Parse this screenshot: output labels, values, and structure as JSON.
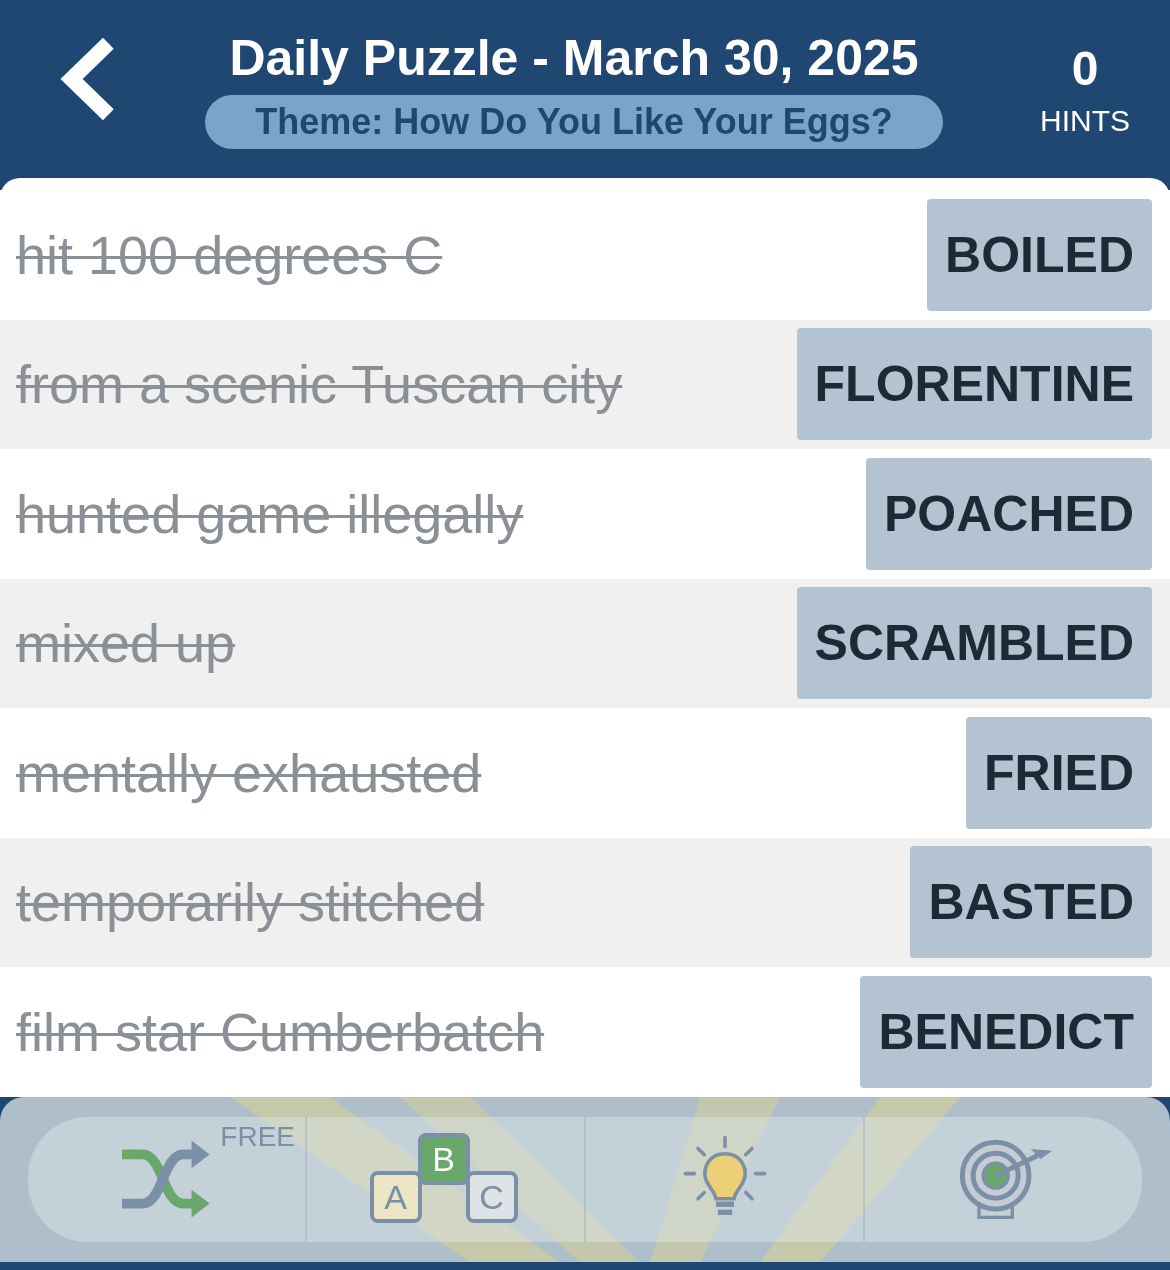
{
  "header": {
    "title": "Daily Puzzle - March 30, 2025",
    "theme": "Theme: How Do You Like Your Eggs?",
    "hints_count": "0",
    "hints_label": "HINTS"
  },
  "clues": [
    {
      "clue": "hit 100 degrees C",
      "answer": "BOILED",
      "solved": true
    },
    {
      "clue": "from a scenic Tuscan city",
      "answer": "FLORENTINE",
      "solved": true
    },
    {
      "clue": "hunted game illegally",
      "answer": "POACHED",
      "solved": true
    },
    {
      "clue": "mixed up",
      "answer": "SCRAMBLED",
      "solved": true
    },
    {
      "clue": "mentally exhausted",
      "answer": "FRIED",
      "solved": true
    },
    {
      "clue": "temporarily stitched",
      "answer": "BASTED",
      "solved": true
    },
    {
      "clue": "film star Cumberbatch",
      "answer": "BENEDICT",
      "solved": true
    }
  ],
  "toolbar": [
    {
      "kind": "shuffle",
      "badge": "FREE"
    },
    {
      "kind": "letters",
      "letters": [
        "A",
        "B",
        "C"
      ]
    },
    {
      "kind": "hint"
    },
    {
      "kind": "target"
    }
  ]
}
